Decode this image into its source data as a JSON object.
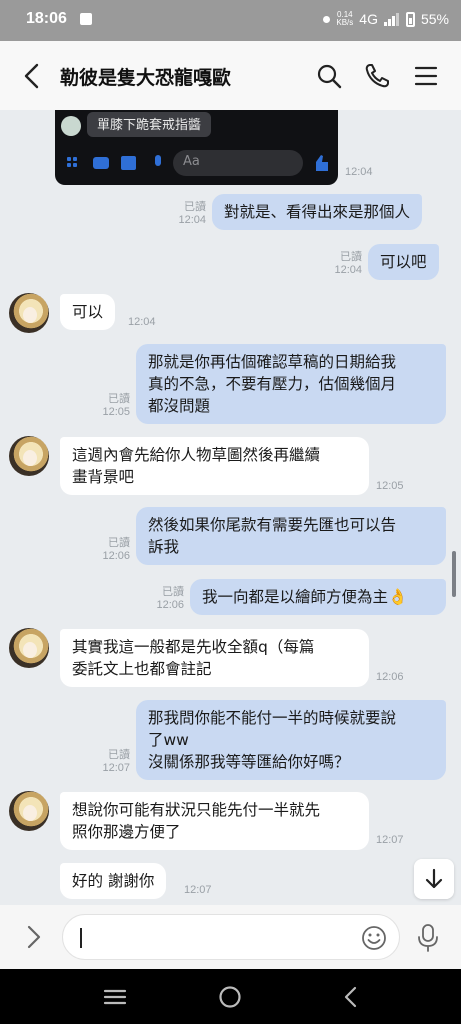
{
  "status_bar": {
    "time": "18:06",
    "speed_top": "0.14",
    "speed_bottom": "KB/s",
    "network": "4G",
    "battery": "55%"
  },
  "header": {
    "title": "勒彼是隻大恐龍嘎歐"
  },
  "image_message": {
    "chip_text": "單膝下跪套戒指醬",
    "input_placeholder": "Aa",
    "time": "12:04"
  },
  "messages": [
    {
      "dir": "out",
      "read": "已讀",
      "time": "12:04",
      "lines": [
        "對就是、看得出來是那個人"
      ]
    },
    {
      "dir": "out",
      "read": "已讀",
      "time": "12:04",
      "lines": [
        "可以吧"
      ]
    },
    {
      "dir": "in",
      "time": "12:04",
      "lines": [
        "可以"
      ]
    },
    {
      "dir": "out",
      "read": "已讀",
      "time": "12:05",
      "lines": [
        "那就是你再估個確認草稿的日期給我",
        "真的不急，不要有壓力，估個幾個月",
        "都沒問題"
      ]
    },
    {
      "dir": "in",
      "time": "12:05",
      "lines": [
        "這週內會先給你人物草圖然後再繼續",
        "畫背景吧"
      ]
    },
    {
      "dir": "out",
      "read": "已讀",
      "time": "12:06",
      "lines": [
        "然後如果你尾款有需要先匯也可以告",
        "訴我"
      ]
    },
    {
      "dir": "out",
      "read": "已讀",
      "time": "12:06",
      "lines": [
        "我一向都是以繪師方便為主👌"
      ]
    },
    {
      "dir": "in",
      "time": "12:06",
      "lines": [
        "其實我這一般都是先收全額q（每篇",
        "委託文上也都會註記"
      ]
    },
    {
      "dir": "out",
      "read": "已讀",
      "time": "12:07",
      "lines": [
        "那我問你能不能付一半的時候就要說",
        "了ww",
        "沒關係那我等等匯給你好嗎？"
      ]
    },
    {
      "dir": "in",
      "time": "12:07",
      "lines": [
        "想說你可能有狀況只能先付一半就先",
        "照你那邊方便了"
      ]
    },
    {
      "dir": "in",
      "time": "12:07",
      "lines": [
        "好的 謝謝你"
      ]
    }
  ],
  "icons": {
    "back": "chevron-left-icon",
    "search": "search-icon",
    "call": "phone-icon",
    "menu": "hamburger-menu-icon",
    "expand": "chevron-right-icon",
    "emoji": "smiley-icon",
    "mic": "microphone-icon",
    "scroll_down": "arrow-down-icon"
  },
  "colors": {
    "outgoing_bubble": "#c9d9f2",
    "incoming_bubble": "#ffffff",
    "chat_background": "#e9ecef"
  }
}
